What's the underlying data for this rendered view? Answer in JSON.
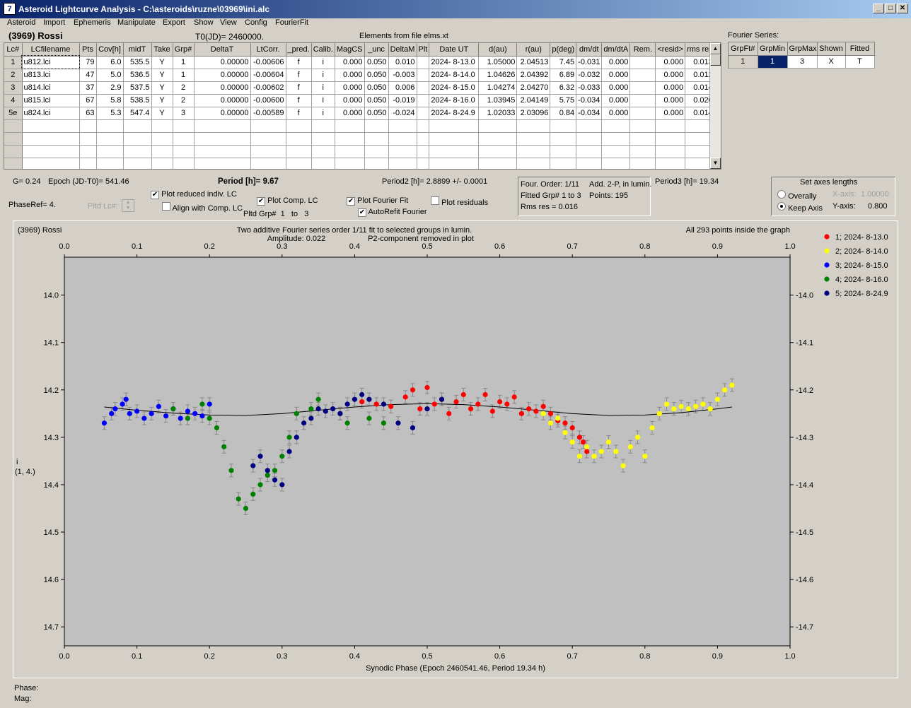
{
  "window": {
    "title": "Asteroid Lightcurve Analysis - C:\\asteroids\\ruzne\\03969\\ini.alc",
    "icon": "app-logo-icon"
  },
  "menu": [
    "Asteroid",
    "Import",
    "Ephemeris",
    "Manipulate",
    "Export",
    "Show",
    "View",
    "Config",
    "FourierFit"
  ],
  "header": {
    "asteroid": "(3969) Rossi",
    "t0": "T0(JD)= 2460000.",
    "elements": "Elements from file elms.xt"
  },
  "table": {
    "columns": [
      "Lc#",
      "LCfilename",
      "Pts",
      "Cov[h]",
      "midT",
      "Take",
      "Grp#",
      "DeltaT",
      "LtCorr.",
      "_pred.",
      "Calib.",
      "MagCS",
      "_unc",
      "DeltaM",
      "Plt",
      "Date UT",
      "d(au)",
      "r(au)",
      "p(deg)",
      "dm/dt",
      "dm/dtA",
      "Rem.",
      "<resid>",
      "rms res"
    ],
    "rows": [
      [
        "1",
        "u812.lci",
        "79",
        "6.0",
        "535.5",
        "Y",
        "1",
        "0.00000",
        "-0.00606",
        "f",
        "i",
        "0.000",
        "0.050",
        "0.010",
        "",
        "2024- 8-13.0",
        "1.05000",
        "2.04513",
        "7.45",
        "-0.031",
        "0.000",
        "",
        "0.000",
        "0.013"
      ],
      [
        "2",
        "u813.lci",
        "47",
        "5.0",
        "536.5",
        "Y",
        "1",
        "0.00000",
        "-0.00604",
        "f",
        "i",
        "0.000",
        "0.050",
        "-0.003",
        "",
        "2024- 8-14.0",
        "1.04626",
        "2.04392",
        "6.89",
        "-0.032",
        "0.000",
        "",
        "0.000",
        "0.012"
      ],
      [
        "3",
        "u814.lci",
        "37",
        "2.9",
        "537.5",
        "Y",
        "2",
        "0.00000",
        "-0.00602",
        "f",
        "i",
        "0.000",
        "0.050",
        "0.006",
        "",
        "2024- 8-15.0",
        "1.04274",
        "2.04270",
        "6.32",
        "-0.033",
        "0.000",
        "",
        "0.000",
        "0.014"
      ],
      [
        "4",
        "u815.lci",
        "67",
        "5.8",
        "538.5",
        "Y",
        "2",
        "0.00000",
        "-0.00600",
        "f",
        "i",
        "0.000",
        "0.050",
        "-0.019",
        "",
        "2024- 8-16.0",
        "1.03945",
        "2.04149",
        "5.75",
        "-0.034",
        "0.000",
        "",
        "0.000",
        "0.020"
      ],
      [
        "5e",
        "u824.lci",
        "63",
        "5.3",
        "547.4",
        "Y",
        "3",
        "0.00000",
        "-0.00589",
        "f",
        "i",
        "0.000",
        "0.050",
        "-0.024",
        "",
        "2024- 8-24.9",
        "1.02033",
        "2.03096",
        "0.84",
        "-0.034",
        "0.000",
        "",
        "0.000",
        "0.014"
      ]
    ]
  },
  "fourier_series": {
    "label": "Fourier Series:",
    "columns": [
      "GrpFt#",
      "GrpMin",
      "GrpMax",
      "Shown",
      "Fitted"
    ],
    "row": [
      "1",
      "1",
      "3",
      "X",
      "T"
    ]
  },
  "info": {
    "g": "G= 0.24",
    "epoch": "Epoch (JD-T0)= 541.46",
    "period": "Period [h]= 9.67",
    "period2": "Period2 [h]= 2.8899 +/- 0.0001",
    "period3": "Period3 [h]= 19.34",
    "phaseref": "PhaseRef= 4.",
    "pltd_lc": "Pltd Lc#:",
    "pltd_grp": "Pltd Grp#",
    "pltd_grp_from": "1",
    "pltd_grp_to_label": "to",
    "pltd_grp_to": "3"
  },
  "checkboxes": {
    "plot_reduced": {
      "label": "Plot reduced indiv. LC",
      "checked": "✔"
    },
    "align_comp": {
      "label": "Align with Comp. LC",
      "checked": ""
    },
    "plot_comp": {
      "label": "Plot Comp. LC",
      "checked": "✔"
    },
    "plot_fourier": {
      "label": "Plot Fourier Fit",
      "checked": "✔"
    },
    "plot_residuals": {
      "label": "Plot residuals",
      "checked": ""
    },
    "autorefit": {
      "label": "AutoRefit Fourier",
      "checked": "✔"
    }
  },
  "fit_box": {
    "order": "Four. Order:  1/11",
    "add": "Add. 2-P, in lumin.",
    "fitted": "Fitted Grp# 1 to 3",
    "points": "Points: 195",
    "rms": "Rms res      = 0.016"
  },
  "axes_box": {
    "title": "Set axes lengths",
    "overally": "Overally",
    "keep": "Keep Axis",
    "xaxis_label": "X-axis:",
    "xaxis_value": "1.00000",
    "yaxis_label": "Y-axis:",
    "yaxis_value": "0.800"
  },
  "graph": {
    "name": "(3969) Rossi",
    "title1": "Two additive Fourier series order 1/11 fit to selected groups in lumin.",
    "title2": "Amplitude: 0.022",
    "title3": "P2-component removed in plot",
    "inside": "All 293 points inside the graph",
    "xlabel": "Synodic Phase (Epoch 2460541.46, Period 19.34 h)",
    "ylabel1": "i",
    "ylabel2": "(1, 4.)"
  },
  "status": {
    "phase": "Phase:",
    "mag": "Mag:"
  },
  "chart_data": {
    "type": "scatter",
    "xlim": [
      0.0,
      1.0
    ],
    "ylim": [
      14.74,
      13.92
    ],
    "y_inverted": true,
    "xticks": [
      0.0,
      0.1,
      0.2,
      0.3,
      0.4,
      0.5,
      0.6,
      0.7,
      0.8,
      0.9,
      1.0
    ],
    "yticks": [
      14.0,
      14.1,
      14.2,
      14.3,
      14.4,
      14.5,
      14.6,
      14.7
    ],
    "legend_position": "right",
    "fourier_fit": {
      "x": [
        0.055,
        0.1,
        0.15,
        0.2,
        0.25,
        0.3,
        0.35,
        0.4,
        0.45,
        0.5,
        0.55,
        0.6,
        0.65,
        0.7,
        0.75,
        0.8,
        0.85,
        0.9,
        0.92
      ],
      "y": [
        14.236,
        14.243,
        14.249,
        14.253,
        14.254,
        14.25,
        14.243,
        14.236,
        14.231,
        14.229,
        14.231,
        14.236,
        14.243,
        14.25,
        14.254,
        14.253,
        14.248,
        14.24,
        14.236
      ]
    },
    "series": [
      {
        "name": "1; 2024- 8-13.0",
        "color": "#ff0000",
        "x": [
          0.41,
          0.43,
          0.45,
          0.47,
          0.48,
          0.49,
          0.5,
          0.51,
          0.52,
          0.53,
          0.54,
          0.55,
          0.56,
          0.57,
          0.58,
          0.59,
          0.6,
          0.61,
          0.62,
          0.63,
          0.64,
          0.65,
          0.66,
          0.67,
          0.68,
          0.69,
          0.7,
          0.71,
          0.715,
          0.72
        ],
        "y": [
          14.225,
          14.23,
          14.235,
          14.215,
          14.2,
          14.24,
          14.195,
          14.23,
          14.22,
          14.25,
          14.225,
          14.21,
          14.24,
          14.23,
          14.21,
          14.245,
          14.225,
          14.23,
          14.215,
          14.25,
          14.24,
          14.245,
          14.235,
          14.25,
          14.265,
          14.27,
          14.28,
          14.3,
          14.31,
          14.33
        ]
      },
      {
        "name": "2; 2024- 8-14.0",
        "color": "#ffff00",
        "x": [
          0.66,
          0.67,
          0.68,
          0.69,
          0.7,
          0.71,
          0.72,
          0.73,
          0.74,
          0.75,
          0.76,
          0.77,
          0.78,
          0.79,
          0.8,
          0.81,
          0.82,
          0.83,
          0.84,
          0.85,
          0.86,
          0.87,
          0.88,
          0.89,
          0.9,
          0.91,
          0.92
        ],
        "y": [
          14.25,
          14.27,
          14.26,
          14.29,
          14.31,
          14.34,
          14.32,
          14.34,
          14.33,
          14.31,
          14.33,
          14.36,
          14.32,
          14.3,
          14.34,
          14.28,
          14.25,
          14.23,
          14.24,
          14.235,
          14.24,
          14.235,
          14.23,
          14.24,
          14.22,
          14.2,
          14.19
        ]
      },
      {
        "name": "3; 2024- 8-15.0",
        "color": "#0000ff",
        "x": [
          0.055,
          0.065,
          0.07,
          0.08,
          0.085,
          0.09,
          0.1,
          0.11,
          0.12,
          0.13,
          0.14,
          0.15,
          0.16,
          0.17,
          0.18,
          0.19,
          0.2
        ],
        "y": [
          14.27,
          14.25,
          14.24,
          14.23,
          14.22,
          14.25,
          14.245,
          14.26,
          14.25,
          14.235,
          14.255,
          14.24,
          14.26,
          14.245,
          14.25,
          14.255,
          14.23
        ]
      },
      {
        "name": "4; 2024- 8-16.0",
        "color": "#008000",
        "x": [
          0.15,
          0.17,
          0.19,
          0.2,
          0.21,
          0.22,
          0.23,
          0.24,
          0.25,
          0.26,
          0.27,
          0.28,
          0.29,
          0.3,
          0.31,
          0.32,
          0.34,
          0.35,
          0.38,
          0.39,
          0.42,
          0.44
        ],
        "y": [
          14.24,
          14.26,
          14.23,
          14.26,
          14.28,
          14.32,
          14.37,
          14.43,
          14.45,
          14.42,
          14.4,
          14.38,
          14.37,
          14.34,
          14.3,
          14.25,
          14.24,
          14.22,
          14.25,
          14.27,
          14.26,
          14.27
        ]
      },
      {
        "name": "5; 2024- 8-24.9",
        "color": "#000080",
        "x": [
          0.26,
          0.27,
          0.28,
          0.29,
          0.3,
          0.31,
          0.32,
          0.33,
          0.34,
          0.35,
          0.36,
          0.37,
          0.38,
          0.39,
          0.4,
          0.41,
          0.42,
          0.44,
          0.46,
          0.48,
          0.5,
          0.52
        ],
        "y": [
          14.36,
          14.34,
          14.37,
          14.39,
          14.4,
          14.33,
          14.3,
          14.27,
          14.26,
          14.24,
          14.245,
          14.24,
          14.25,
          14.23,
          14.22,
          14.21,
          14.22,
          14.23,
          14.27,
          14.28,
          14.24,
          14.22
        ]
      }
    ]
  }
}
